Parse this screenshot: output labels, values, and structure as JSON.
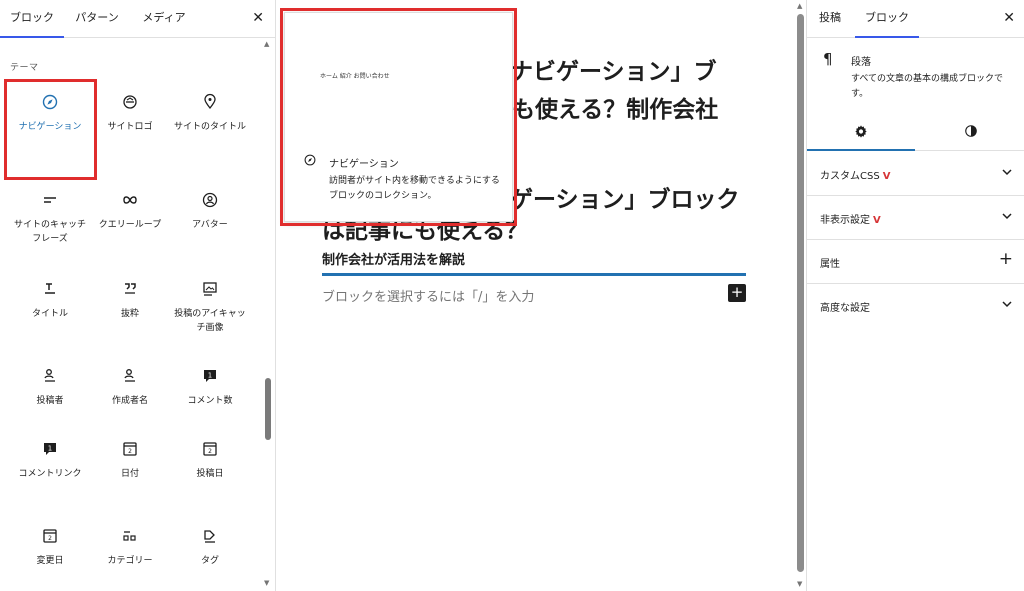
{
  "inserter": {
    "tabs": [
      "ブロック",
      "パターン",
      "メディア"
    ],
    "category_title": "テーマ",
    "blocks": [
      {
        "label": "ナビゲーション",
        "icon": "compass-icon",
        "selected": true
      },
      {
        "label": "サイトロゴ",
        "icon": "site-logo-icon",
        "selected": false
      },
      {
        "label": "サイトのタイトル",
        "icon": "map-marker-icon",
        "selected": false
      },
      {
        "label": "サイトのキャッチフレーズ",
        "icon": "tagline-icon",
        "selected": false
      },
      {
        "label": "クエリーループ",
        "icon": "loop-icon",
        "selected": false
      },
      {
        "label": "アバター",
        "icon": "avatar-icon",
        "selected": false
      },
      {
        "label": "タイトル",
        "icon": "title-icon",
        "selected": false
      },
      {
        "label": "抜粋",
        "icon": "excerpt-quote-icon",
        "selected": false
      },
      {
        "label": "投稿のアイキャッチ画像",
        "icon": "featured-image-icon",
        "selected": false
      },
      {
        "label": "投稿者",
        "icon": "author-icon",
        "selected": false
      },
      {
        "label": "作成者名",
        "icon": "author-name-icon",
        "selected": false
      },
      {
        "label": "コメント数",
        "icon": "comment-count-icon",
        "selected": false
      },
      {
        "label": "コメントリンク",
        "icon": "comment-link-icon",
        "selected": false
      },
      {
        "label": "日付",
        "icon": "calendar-icon",
        "selected": false
      },
      {
        "label": "投稿日",
        "icon": "post-date-icon",
        "selected": false
      },
      {
        "label": "変更日",
        "icon": "modified-date-icon",
        "selected": false
      },
      {
        "label": "カテゴリー",
        "icon": "categories-icon",
        "selected": false
      },
      {
        "label": "タグ",
        "icon": "tag-icon",
        "selected": false
      }
    ]
  },
  "canvas": {
    "heading_line1": "ナビゲーション」ブ",
    "heading_line2": "も使える？制作会社",
    "heading_line3": "ゲーション」ブロック",
    "heading_line4": "は記事にも使える？",
    "subheading": "制作会社が活用法を解説",
    "placeholder": "ブロックを選択するには「/」を入力",
    "add_block_label": "+"
  },
  "preview": {
    "nav_links": "ホーム  紹介  お問い合わせ",
    "title": "ナビゲーション",
    "description": "訪問者がサイト内を移動できるようにするブロックのコレクション。"
  },
  "settings": {
    "tabs": [
      "投稿",
      "ブロック"
    ],
    "block_title": "段落",
    "block_description": "すべての文章の基本の構成ブロックです。",
    "panels": [
      {
        "label": "カスタムCSS",
        "badge": true,
        "control": "chevron"
      },
      {
        "label": "非表示設定",
        "badge": true,
        "control": "chevron"
      },
      {
        "label": "属性",
        "badge": false,
        "control": "plus"
      },
      {
        "label": "高度な設定",
        "badge": false,
        "control": "chevron"
      }
    ],
    "badge_text": "V"
  },
  "colors": {
    "accent": "#3858e9",
    "selected_label": "#2271b1",
    "highlight": "#e02d2d"
  }
}
